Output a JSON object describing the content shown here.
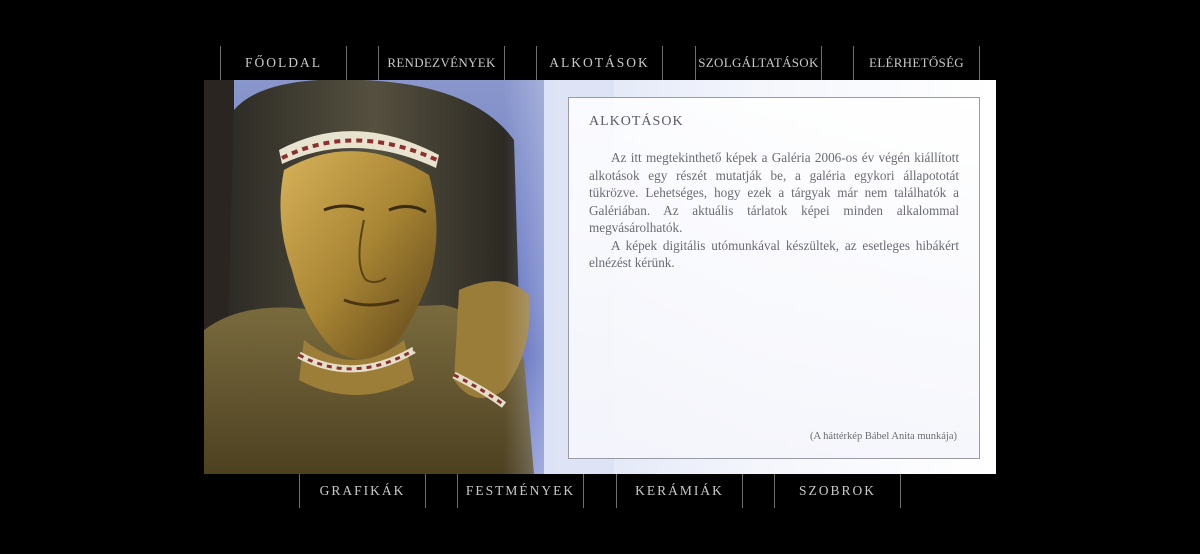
{
  "top_nav": [
    {
      "label": "FŐOLDAL"
    },
    {
      "label": "RENDEZVÉNYEK"
    },
    {
      "label": "ALKOTÁSOK"
    },
    {
      "label": "SZOLGÁLTATÁSOK"
    },
    {
      "label": "ELÉRHETŐSÉG"
    }
  ],
  "bottom_nav": [
    {
      "label": "GRAFIKÁK"
    },
    {
      "label": "FESTMÉNYEK"
    },
    {
      "label": "KERÁMIÁK"
    },
    {
      "label": "SZOBROK"
    }
  ],
  "content": {
    "title": "ALKOTÁSOK",
    "paragraph1": "Az itt megtekinthető képek a Galéria 2006-os év végén kiállított alkotások egy részét mutatják be, a galéria egykori állapototát tükrözve. Lehetséges, hogy ezek a tárgyak már nem találhatók a Galériában. Az aktuális tárlatok képei minden alkalommal megvásárolhatók.",
    "paragraph2": "A képek digitális utómunkával készültek, az esetleges hibákért elnézést kérünk.",
    "credit": "(A háttérkép Bábel Anita munkája)"
  }
}
